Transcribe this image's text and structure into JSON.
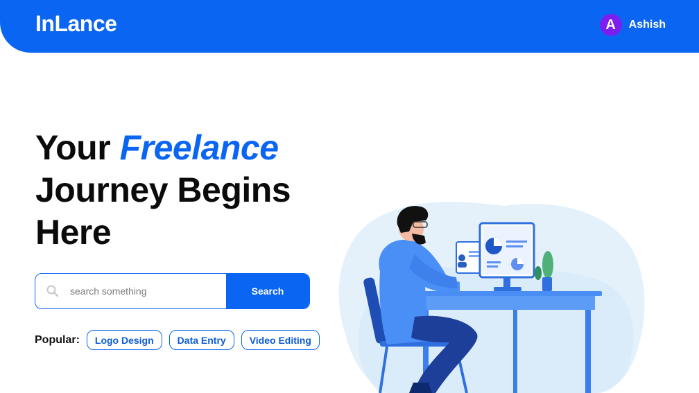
{
  "header": {
    "brand": "InLance",
    "user": {
      "avatar_initial": "A",
      "name": "Ashish"
    }
  },
  "hero": {
    "title_prefix": "Your ",
    "title_accent": "Freelance",
    "title_rest": "Journey Begins Here"
  },
  "search": {
    "placeholder": "search something",
    "value": "",
    "button_label": "Search"
  },
  "popular": {
    "label": "Popular:",
    "tags": [
      "Logo Design",
      "Data Entry",
      "Video Editing"
    ]
  },
  "colors": {
    "primary": "#0a66f2",
    "avatar": "#7a1ff0",
    "text": "#0b0b0b"
  },
  "illustration": {
    "subject": "freelancer-at-desk",
    "icons": [
      "person-icon",
      "pie-chart-icon",
      "plant-icon"
    ]
  }
}
